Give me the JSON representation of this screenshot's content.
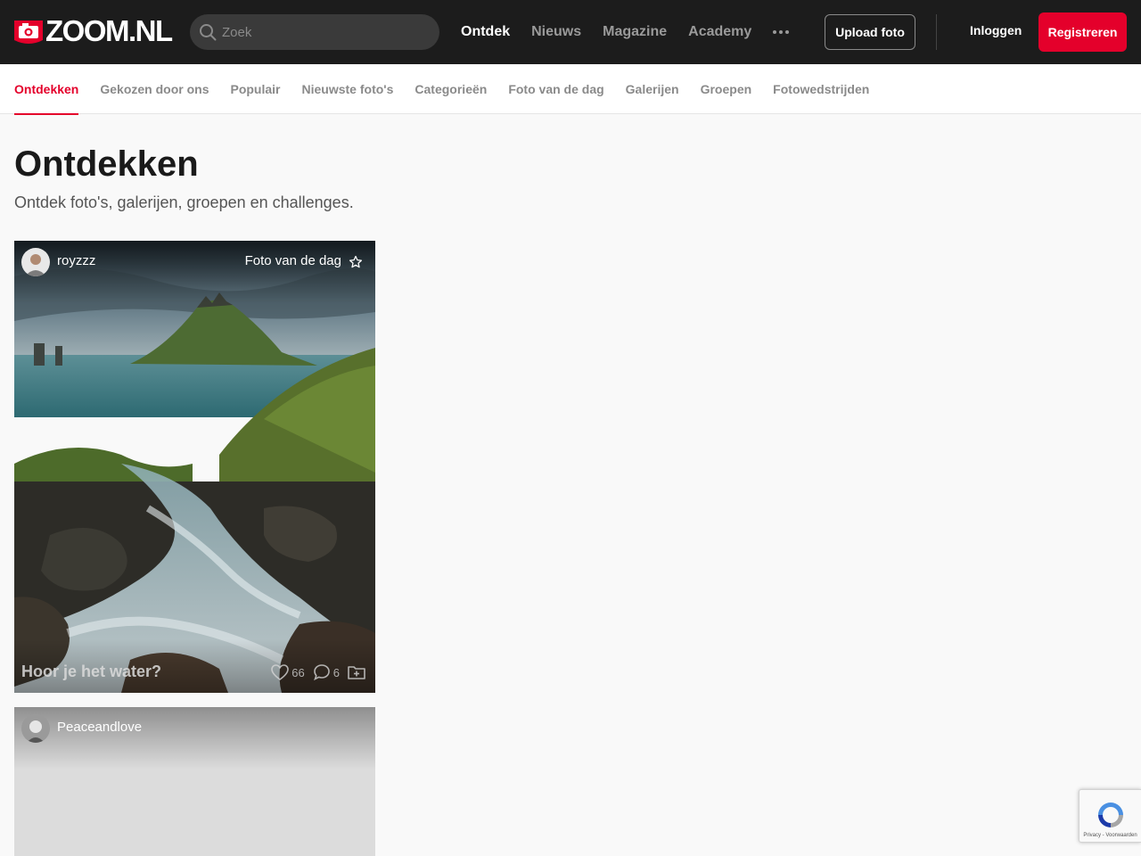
{
  "header": {
    "logo_text": "ZOOM.NL",
    "search_placeholder": "Zoek",
    "nav": [
      "Ontdek",
      "Nieuws",
      "Magazine",
      "Academy"
    ],
    "upload_label": "Upload foto",
    "login_label": "Inloggen",
    "register_label": "Registreren",
    "colors": {
      "bar": "#1c1c1c",
      "accent": "#e4002b"
    }
  },
  "subnav": {
    "items": [
      "Ontdekken",
      "Gekozen door ons",
      "Populair",
      "Nieuwste foto's",
      "Categorieën",
      "Foto van de dag",
      "Galerijen",
      "Groepen",
      "Fotowedstrijden"
    ],
    "active": "Ontdekken"
  },
  "page": {
    "title": "Ontdekken",
    "subtitle": "Ontdek foto's, galerijen, groepen en challenges."
  },
  "cards": [
    {
      "username": "royzzz",
      "badge": "Foto van de dag",
      "title": "Hoor je het water?",
      "likes": "66",
      "comments": "6"
    },
    {
      "username": "Peaceandlove"
    }
  ],
  "recaptcha": {
    "text": "Privacy - Voorwaarden"
  }
}
